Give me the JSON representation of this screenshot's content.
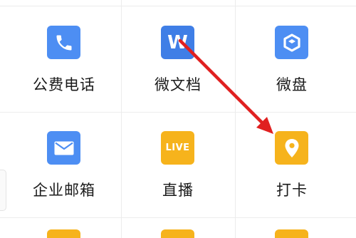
{
  "apps": [
    {
      "label": "公费电话",
      "icon": "phone-icon",
      "color": "#4d8ef3"
    },
    {
      "label": "微文档",
      "icon": "word-doc-icon",
      "color": "#3f7ee6",
      "glyph": "W"
    },
    {
      "label": "微盘",
      "icon": "cloud-drive-icon",
      "color": "#4d8ef3"
    },
    {
      "label": "企业邮箱",
      "icon": "mail-icon",
      "color": "#4d8ef3"
    },
    {
      "label": "直播",
      "icon": "live-icon",
      "color": "#f6b31c",
      "glyph": "LIVE"
    },
    {
      "label": "打卡",
      "icon": "location-pin-icon",
      "color": "#f6b31c"
    }
  ],
  "annotation": {
    "type": "red-arrow",
    "from": "微文档",
    "to": "打卡",
    "color": "#e02020"
  }
}
